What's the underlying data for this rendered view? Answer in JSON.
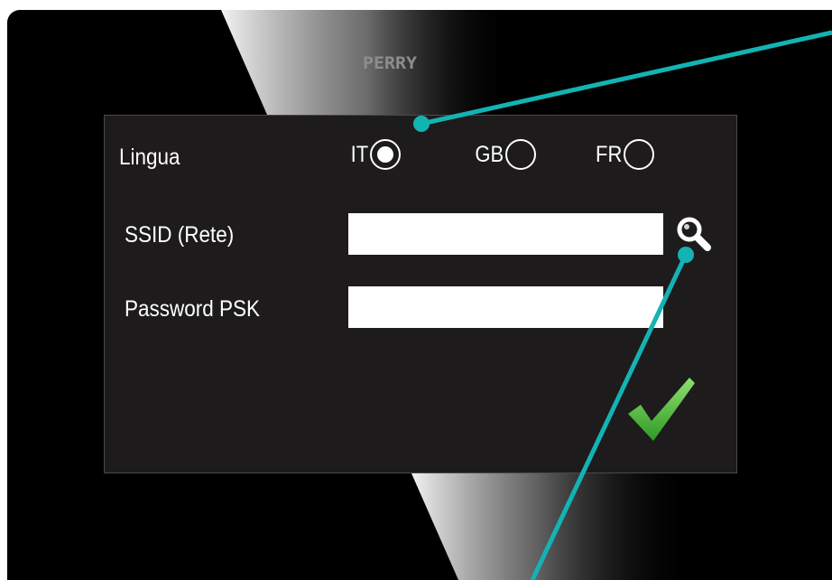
{
  "brand": {
    "logo_text": "PERRY"
  },
  "form": {
    "language_label": "Lingua",
    "languages": [
      {
        "code": "IT",
        "selected": true
      },
      {
        "code": "GB",
        "selected": false
      },
      {
        "code": "FR",
        "selected": false
      }
    ],
    "ssid_label": "SSID (Rete)",
    "ssid_value": "",
    "password_label": "Password PSK",
    "password_value": ""
  },
  "icons": {
    "search": "magnifier-icon",
    "confirm": "checkmark-icon"
  },
  "colors": {
    "background": "#000000",
    "panel": "#1d1b1c",
    "callout": "#14b3b3",
    "confirm": "#4fbf3a"
  }
}
